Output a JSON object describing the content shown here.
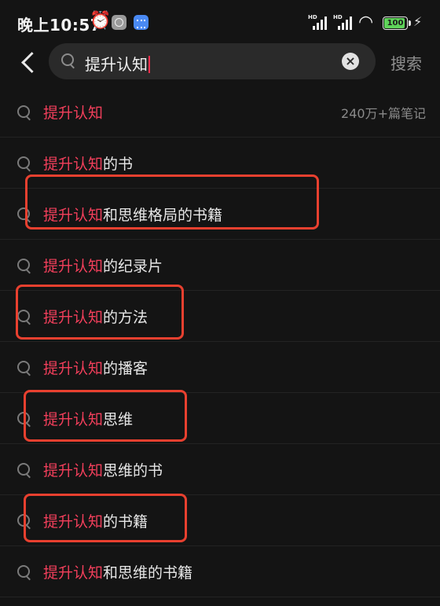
{
  "status_bar": {
    "time": "晚上10:57",
    "signal1_label": "HD",
    "signal2_label": "HD",
    "battery_percent": "100",
    "battery_level": 1.0
  },
  "search": {
    "query": "提升认知",
    "clear_symbol": "×",
    "submit_label": "搜索"
  },
  "suggestions": [
    {
      "highlight": "提升认知",
      "suffix": "",
      "count": "240万+篇笔记"
    },
    {
      "highlight": "提升认知",
      "suffix": "的书"
    },
    {
      "highlight": "提升认知",
      "suffix": "和思维格局的书籍"
    },
    {
      "highlight": "提升认知",
      "suffix": "的纪录片"
    },
    {
      "highlight": "提升认知",
      "suffix": "的方法"
    },
    {
      "highlight": "提升认知",
      "suffix": "的播客"
    },
    {
      "highlight": "提升认知",
      "suffix": "思维"
    },
    {
      "highlight": "提升认知",
      "suffix": "思维的书"
    },
    {
      "highlight": "提升认知",
      "suffix": "的书籍"
    },
    {
      "highlight": "提升认知",
      "suffix": "和思维的书籍"
    }
  ],
  "annotations": {
    "marked_rows": [
      2,
      4,
      6,
      8
    ],
    "color": "#e8402f"
  },
  "colors": {
    "highlight": "#f23f5b",
    "background": "#141414"
  }
}
